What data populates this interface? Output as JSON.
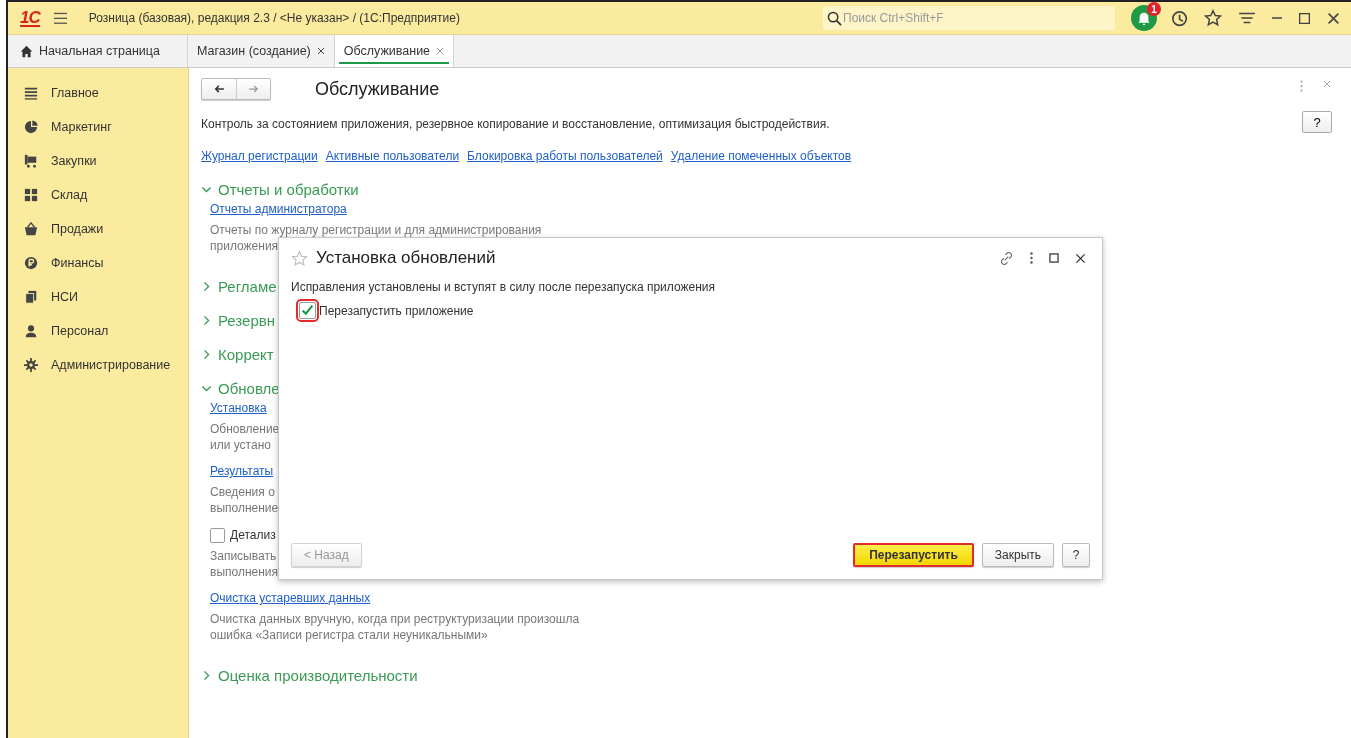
{
  "titlebar": {
    "logo": "1С",
    "title": "Розница (базовая), редакция 2.3 / <Не указан> /  (1С:Предприятие)",
    "search": {
      "placeholder": "Поиск Ctrl+Shift+F"
    },
    "notification_badge": "1"
  },
  "tabs": [
    {
      "label": "Начальная страница",
      "kind": "home",
      "selected": false
    },
    {
      "label": "Магазин (создание)",
      "kind": "closable",
      "selected": false
    },
    {
      "label": "Обслуживание",
      "kind": "closable",
      "selected": true
    }
  ],
  "sidebar": {
    "items": [
      {
        "label": "Главное",
        "selected": false
      },
      {
        "label": "Маркетинг",
        "selected": false
      },
      {
        "label": "Закупки",
        "selected": false
      },
      {
        "label": "Склад",
        "selected": false
      },
      {
        "label": "Продажи",
        "selected": false
      },
      {
        "label": "Финансы",
        "selected": false
      },
      {
        "label": "НСИ",
        "selected": false
      },
      {
        "label": "Персонал",
        "selected": false
      },
      {
        "label": "Администрирование",
        "selected": false
      }
    ]
  },
  "page": {
    "title": "Обслуживание",
    "description": "Контроль за состоянием приложения, резервное копирование и восстановление, оптимизация быстродействия.",
    "help": "?",
    "links": [
      "Журнал регистрации",
      "Активные пользователи",
      "Блокировка работы пользователей",
      "Удаление помеченных объектов"
    ],
    "sections": [
      {
        "title": "Отчеты и обработки",
        "expanded": true,
        "items": [
          {
            "kind": "link",
            "text": "Отчеты администратора"
          },
          {
            "kind": "note",
            "lines": [
              "Отчеты по журналу регистрации и для администрирования",
              "приложения"
            ]
          }
        ]
      },
      {
        "title": "Регламе",
        "expanded": false
      },
      {
        "title": "Резервн",
        "expanded": false
      },
      {
        "title": "Коррект",
        "expanded": false
      },
      {
        "title": "Обновле",
        "expanded": true,
        "items": [
          {
            "kind": "link",
            "text": "Установка"
          },
          {
            "kind": "note",
            "lines": [
              "Обновление",
              "или устано"
            ]
          },
          {
            "kind": "link",
            "text": "Результаты"
          },
          {
            "kind": "note",
            "lines": [
              "Сведения о",
              "выполнение"
            ]
          },
          {
            "kind": "checkbox",
            "text": "Детализ",
            "checked": false
          },
          {
            "kind": "note",
            "lines": [
              "Записывать",
              "выполнения"
            ]
          },
          {
            "kind": "link",
            "text": "Очистка устаревших данных"
          },
          {
            "kind": "note",
            "lines": [
              "Очистка данных вручную, когда при реструктуризации произошла",
              "ошибка «Записи регистра стали неуникальными»"
            ]
          }
        ]
      },
      {
        "title": "Оценка производительности",
        "expanded": false
      }
    ]
  },
  "dialog": {
    "title": "Установка обновлений",
    "message": "Исправления установлены и вступят в силу после перезапуска приложения",
    "checkbox": {
      "label": "Перезапустить приложение",
      "checked": true,
      "highlighted": true
    },
    "buttons": [
      {
        "label": "< Назад",
        "kind": "plain",
        "disabled": true,
        "highlighted": false
      },
      {
        "label": "Перезапустить",
        "kind": "default",
        "disabled": false,
        "highlighted": true
      },
      {
        "label": "Закрыть",
        "kind": "plain",
        "disabled": false,
        "highlighted": false
      },
      {
        "label": "?",
        "kind": "plain",
        "disabled": false,
        "highlighted": false
      }
    ]
  }
}
